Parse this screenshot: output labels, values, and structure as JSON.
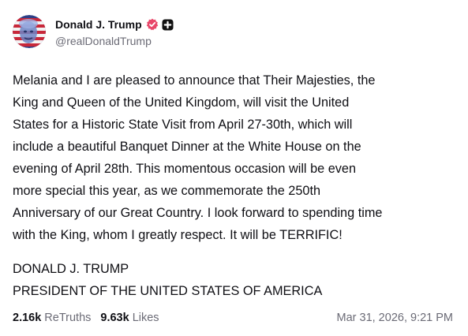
{
  "post": {
    "author": {
      "display_name": "Donald J. Trump",
      "handle": "@realDonaldTrump",
      "verified_icon": "verified-badge-icon",
      "plus_icon": "plus-badge-icon"
    },
    "body": "Melania and I are pleased to announce that Their Majesties, the\nKing and Queen of the United Kingdom, will visit the United\nStates for a Historic State Visit from April 27-30th, which will\ninclude a beautiful Banquet Dinner at the White House on the\nevening of April 28th. This momentous occasion will be even\nmore special this year, as we commemorate the 250th\nAnniversary of our Great Country. I look forward to spending time\nwith the King, whom I greatly respect. It will be TERRIFIC!",
    "signature": "DONALD J. TRUMP\nPRESIDENT OF THE UNITED STATES OF AMERICA",
    "stats": {
      "retruths_count": "2.16k",
      "retruths_label": "ReTruths",
      "likes_count": "9.63k",
      "likes_label": "Likes"
    },
    "timestamp": "Mar 31, 2026, 9:21 PM"
  },
  "colors": {
    "text_primary": "#0f0f14",
    "text_secondary": "#6b6b76",
    "verified_badge": "#e8476a",
    "plus_badge": "#111111",
    "background": "#ffffff"
  }
}
